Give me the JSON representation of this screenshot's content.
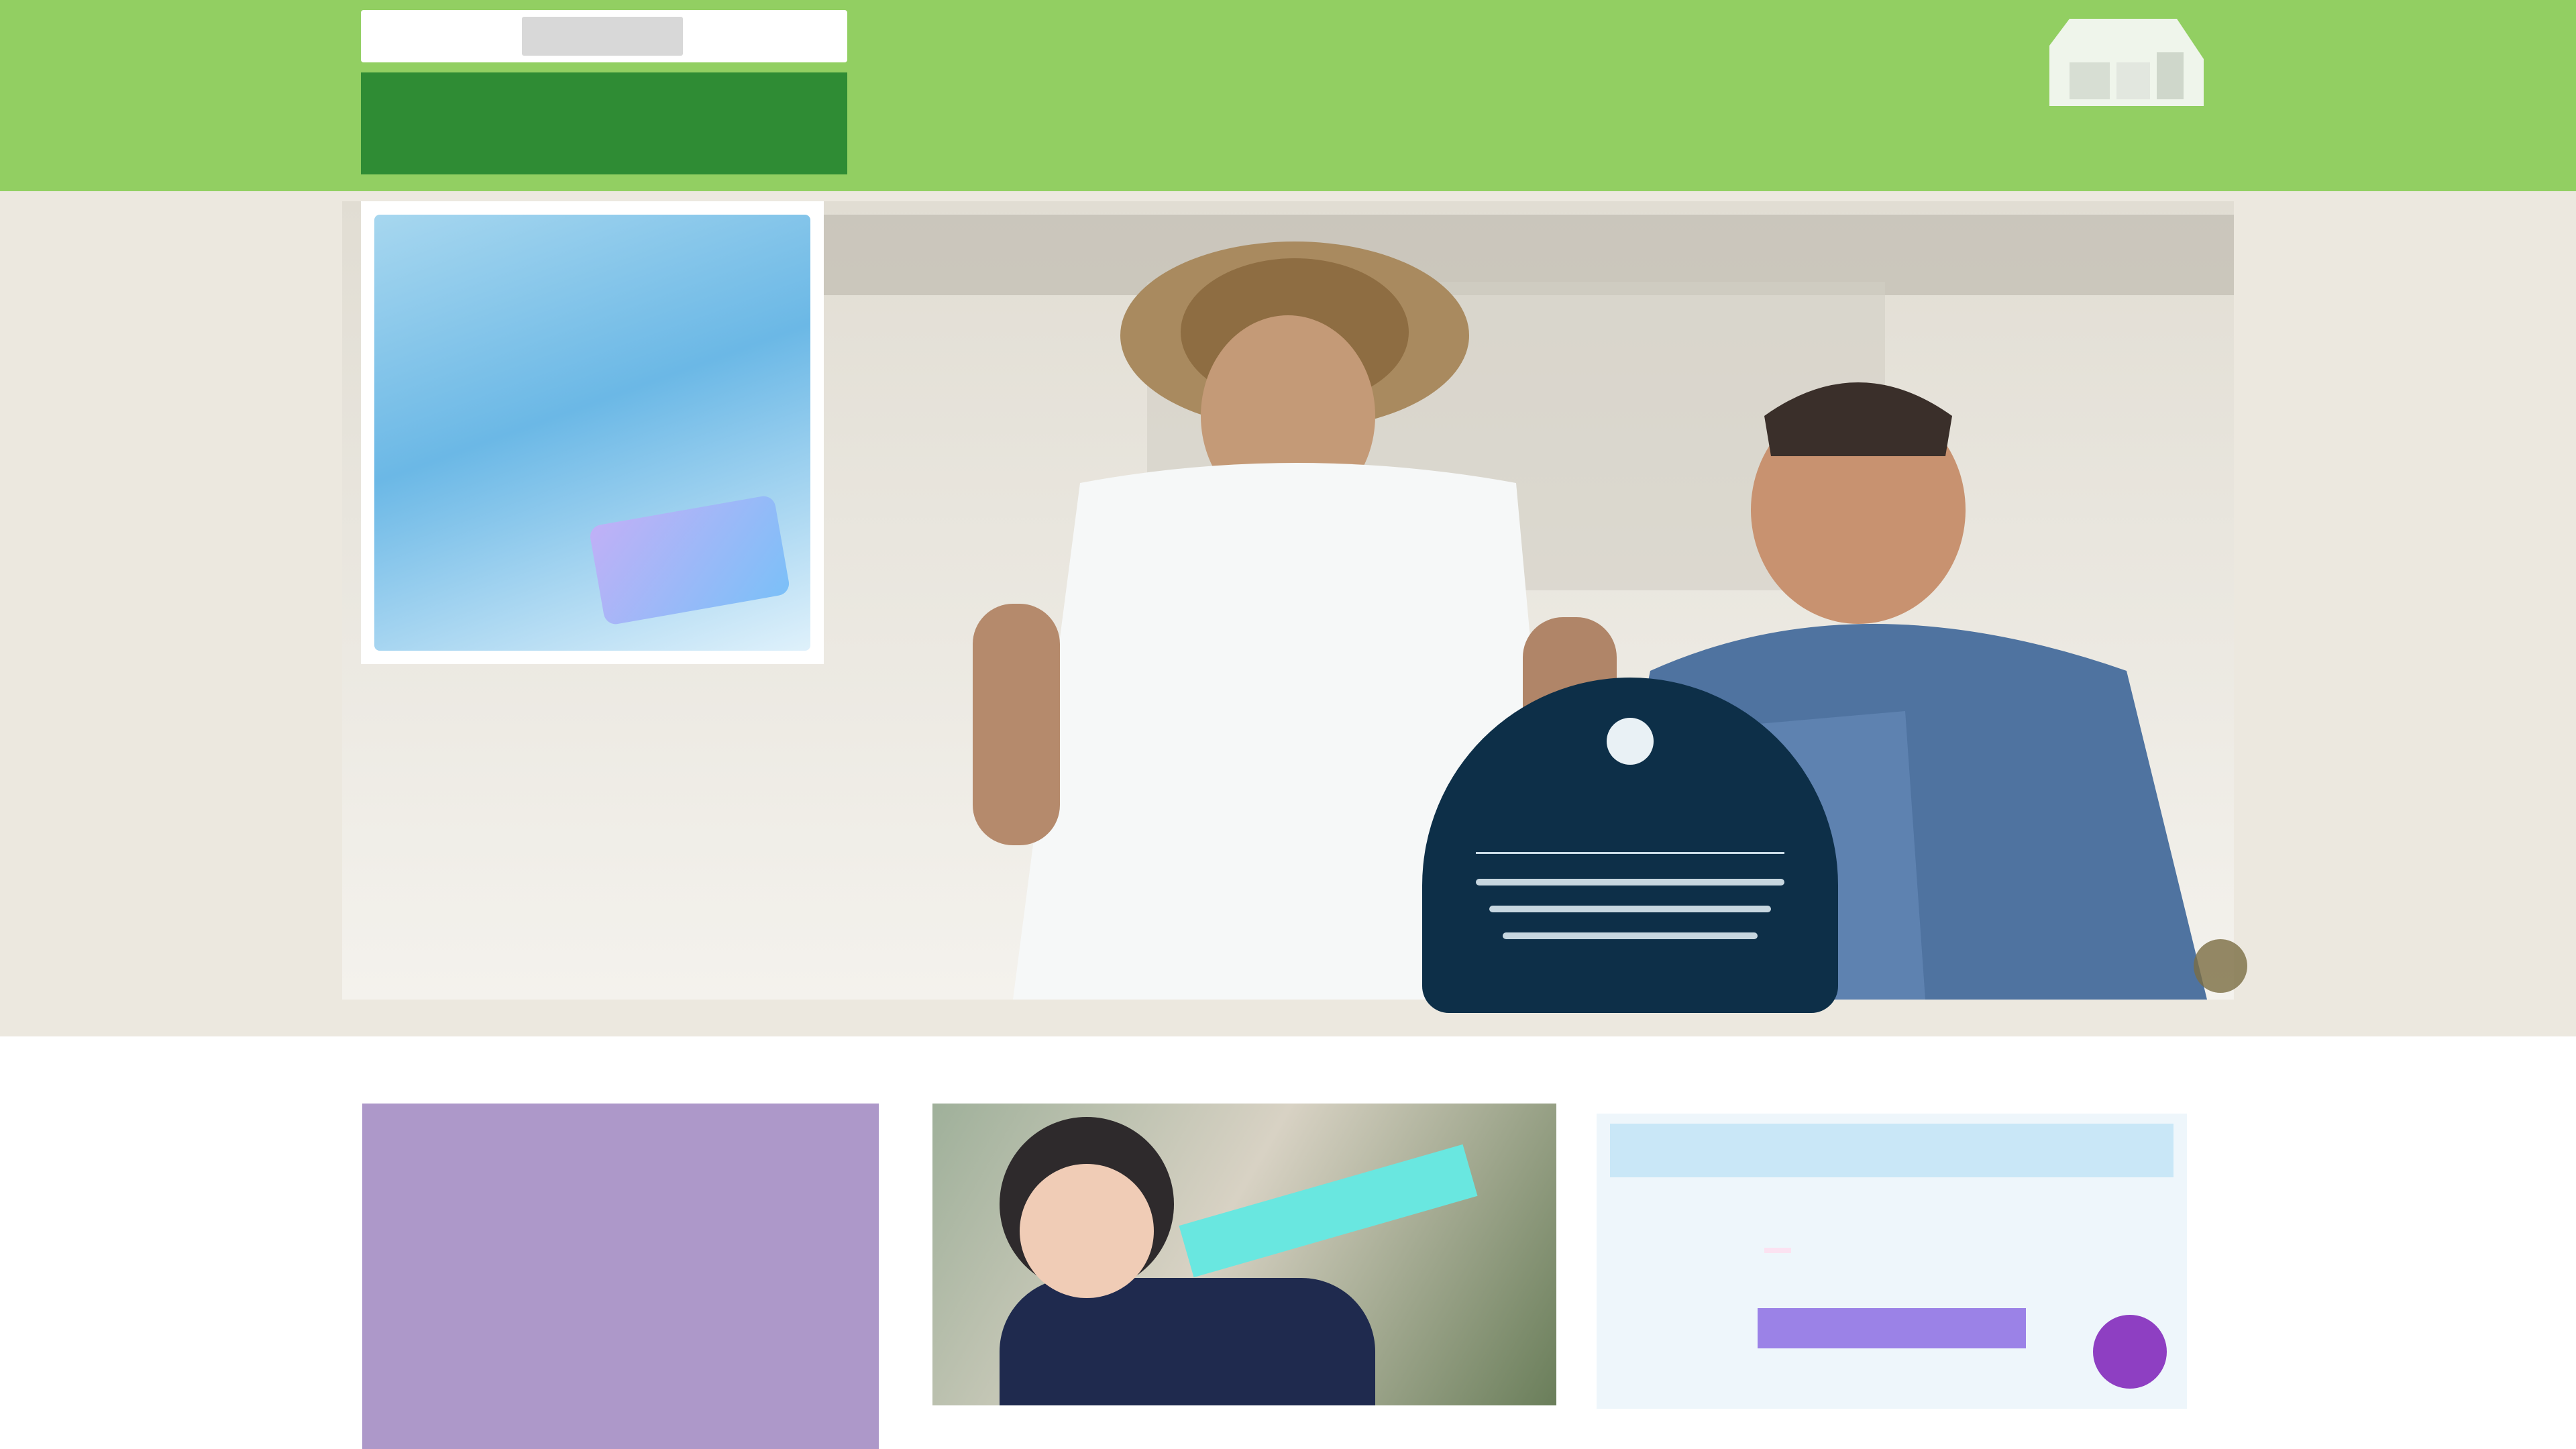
{
  "header": {
    "logo_mark": "",
    "logo_text": "",
    "brand": "",
    "top_links": [],
    "right_links": [],
    "nav": [],
    "nav_end": ""
  },
  "hero": {
    "side_card": {
      "title_right": "",
      "title_left": "",
      "tag": ""
    },
    "caption_a": "",
    "caption_b": "",
    "caption_c": "",
    "badge_title": ""
  },
  "cards": {
    "card1_title": "",
    "card2_stripe": "",
    "card3_title": "",
    "card3_subtitle": "",
    "card3_highlight": "",
    "card3_button": ""
  },
  "colors": {
    "header_bg": "#92cf62",
    "logo_green": "#2f8c34",
    "hero_band": "#ece8df",
    "card1": "#ad98c9"
  }
}
